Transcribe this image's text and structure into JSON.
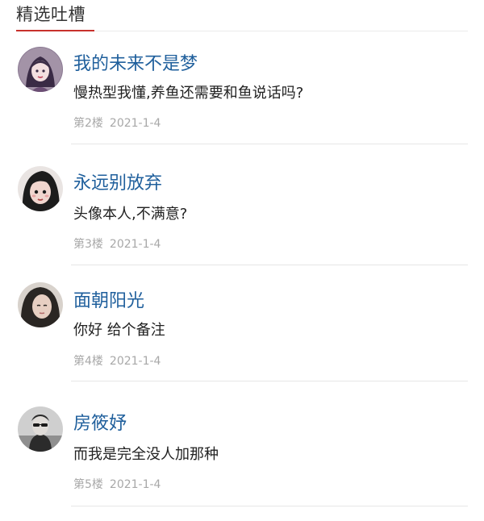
{
  "section": {
    "title": "精选吐槽"
  },
  "comments": [
    {
      "username": "我的未来不是梦",
      "text": "慢热型我懂,养鱼还需要和鱼说话吗?",
      "floor": "第2楼",
      "date": "2021-1-4",
      "avatar_icon": "woman-illustration-avatar"
    },
    {
      "username": "永远别放弃",
      "text": "头像本人,不满意?",
      "floor": "第3楼",
      "date": "2021-1-4",
      "avatar_icon": "cartoon-girl-avatar"
    },
    {
      "username": "面朝阳光",
      "text": "你好 给个备注",
      "floor": "第4楼",
      "date": "2021-1-4",
      "avatar_icon": "girl-photo-avatar"
    },
    {
      "username": "房筱妤",
      "text": "而我是完全没人加那种",
      "floor": "第5楼",
      "date": "2021-1-4",
      "avatar_icon": "monochrome-photo-avatar"
    }
  ],
  "colors": {
    "accent": "#c8312c",
    "username": "#1f5f9c",
    "meta": "#a8a8a8"
  }
}
